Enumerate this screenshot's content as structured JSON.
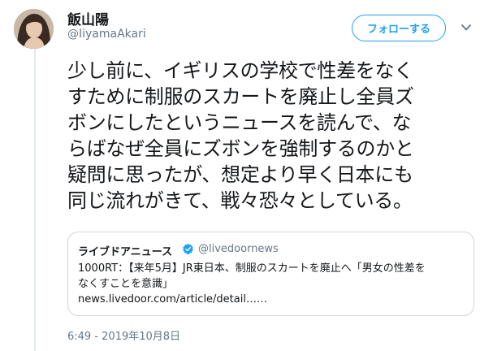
{
  "author": {
    "display_name": "飯山陽",
    "handle": "@IiyamaAkari"
  },
  "follow_button": {
    "label": "フォローする"
  },
  "tweet": {
    "lines": [
      "少し前に、イギリスの学校で性差をなく",
      "すために制服のスカートを廃止し全員ズ",
      "ボンにしたというニュースを読んで、な",
      "らばなぜ全員にズボンを強制するのかと",
      "疑問に思ったが、想定より早く日本にも",
      "同じ流れがきて、戦々恐々としている。"
    ]
  },
  "quote": {
    "display_name": "ライブドアニュース",
    "handle": "@livedoornews",
    "verified": true,
    "body_lines": [
      "1000RT：【来年5月】JR東日本、制服のスカートを廃止へ「男女の性差を",
      "なくすことを意識」",
      "news.livedoor.com/article/detail……"
    ]
  },
  "timestamp": "6:49 - 2019年10月8日",
  "icons": {
    "caret": "chevron-down-icon",
    "verified": "verified-badge-icon"
  },
  "colors": {
    "accent": "#1da1f2",
    "text_primary": "#14171a",
    "text_secondary": "#657786",
    "border": "#ccd6dd",
    "thread_line": "#e1e8ed"
  }
}
